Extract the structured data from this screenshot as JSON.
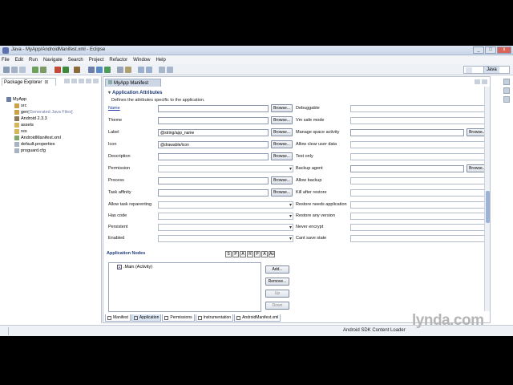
{
  "window": {
    "title": "Java - MyApp/AndroidManifest.xml - Eclipse",
    "buttons": [
      "_",
      "□",
      "x"
    ]
  },
  "menu": [
    "File",
    "Edit",
    "Run",
    "Navigate",
    "Search",
    "Project",
    "Refactor",
    "Window",
    "Help"
  ],
  "perspective": {
    "label": "Java"
  },
  "package_explorer": {
    "tab_label": "Package Explorer",
    "tab_close": "⊠",
    "tree": [
      {
        "label": "MyApp",
        "suffix": ""
      },
      {
        "label": "src",
        "suffix": ""
      },
      {
        "label": "gen",
        "suffix": " [Generated Java Files]"
      },
      {
        "label": "Android 2.3.3",
        "suffix": ""
      },
      {
        "label": "assets",
        "suffix": ""
      },
      {
        "label": "res",
        "suffix": ""
      },
      {
        "label": "AndroidManifest.xml",
        "suffix": ""
      },
      {
        "label": "default.properties",
        "suffix": ""
      },
      {
        "label": "proguard.cfg",
        "suffix": ""
      }
    ]
  },
  "editor": {
    "tab_label": "MyApp Manifest",
    "section_title": "Application Attributes",
    "section_desc": "Defines the attributes specific to the application.",
    "browse_label": "Browse...",
    "left_fields": [
      {
        "label": "Name",
        "value": "",
        "kind": "browse"
      },
      {
        "label": "Theme",
        "value": "",
        "kind": "browse"
      },
      {
        "label": "Label",
        "value": "@string/app_name",
        "kind": "browse"
      },
      {
        "label": "Icon",
        "value": "@drawable/icon",
        "kind": "browse"
      },
      {
        "label": "Description",
        "value": "",
        "kind": "browse"
      },
      {
        "label": "Permission",
        "value": "",
        "kind": "select"
      },
      {
        "label": "Process",
        "value": "",
        "kind": "browse"
      },
      {
        "label": "Task affinity",
        "value": "",
        "kind": "browse"
      },
      {
        "label": "Allow task reparenting",
        "value": "",
        "kind": "select"
      },
      {
        "label": "Has code",
        "value": "",
        "kind": "select"
      },
      {
        "label": "Persistent",
        "value": "",
        "kind": "select"
      },
      {
        "label": "Enabled",
        "value": "",
        "kind": "select"
      }
    ],
    "right_fields": [
      {
        "label": "Debuggable",
        "kind": "select"
      },
      {
        "label": "Vm safe mode",
        "kind": "select"
      },
      {
        "label": "Manage space activity",
        "kind": "browse"
      },
      {
        "label": "Allow clear user data",
        "kind": "select"
      },
      {
        "label": "Test only",
        "kind": "select"
      },
      {
        "label": "Backup agent",
        "kind": "browse"
      },
      {
        "label": "Allow backup",
        "kind": "select"
      },
      {
        "label": "Kill after restore",
        "kind": "select"
      },
      {
        "label": "Restore needs application",
        "kind": "select"
      },
      {
        "label": "Restore any version",
        "kind": "select"
      },
      {
        "label": "Never encrypt",
        "kind": "select"
      },
      {
        "label": "Cant save state",
        "kind": "select"
      }
    ],
    "nodes_title": "Application Nodes",
    "node_filter_buttons": [
      "S",
      "P",
      "A",
      "R",
      "P",
      "A",
      "Az"
    ],
    "nodes": [
      {
        "icon": "A",
        "label": ".Main (Activity)"
      }
    ],
    "node_actions": [
      "Add...",
      "Remove...",
      "Up",
      "Down"
    ],
    "bottom_tabs": [
      {
        "label": "Manifest",
        "active": false
      },
      {
        "label": "Application",
        "active": true
      },
      {
        "label": "Permissions",
        "active": false
      },
      {
        "label": "Instrumentation",
        "active": false
      },
      {
        "label": "AndroidManifest.xml",
        "active": false
      }
    ]
  },
  "status": {
    "loader": "Android SDK Content Loader"
  },
  "watermark": {
    "brand": "lynda",
    "domain": ".com"
  }
}
